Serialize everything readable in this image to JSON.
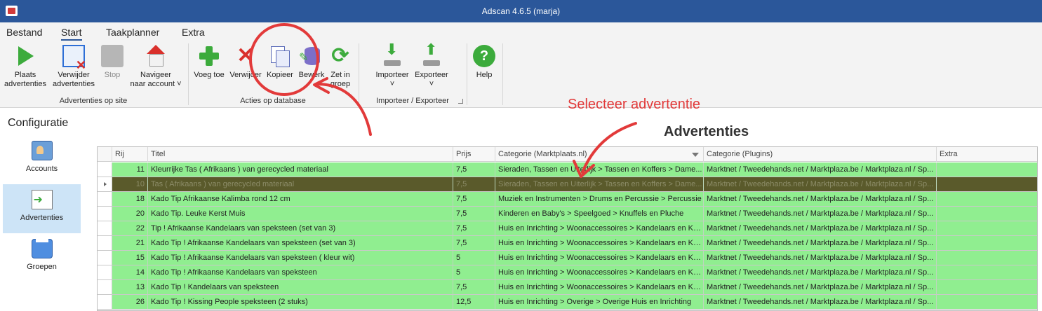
{
  "window": {
    "title": "Adscan 4.6.5 (marja)"
  },
  "menu": {
    "tabs": [
      "Bestand",
      "Start",
      "Taakplanner",
      "Extra"
    ],
    "active": "Start"
  },
  "ribbon": {
    "groups": [
      {
        "label": "Advertenties op site",
        "buttons": [
          {
            "line1": "Plaats",
            "line2": "advertenties",
            "icon": "play-icon"
          },
          {
            "line1": "Verwijder",
            "line2": "advertenties",
            "icon": "remove-ads-icon"
          },
          {
            "line1": "Stop",
            "line2": "",
            "icon": "stop-icon",
            "disabled": true
          },
          {
            "line1": "Navigeer",
            "line2": "naar account",
            "icon": "house-icon",
            "dropdown": "˅"
          }
        ]
      },
      {
        "label": "Acties op database",
        "buttons": [
          {
            "line1": "Voeg toe",
            "line2": "",
            "icon": "plus-icon"
          },
          {
            "line1": "Verwijder",
            "line2": "",
            "icon": "delete-icon"
          },
          {
            "line1": "Kopieer",
            "line2": "",
            "icon": "copy-icon"
          },
          {
            "line1": "Bewerk",
            "line2": "",
            "icon": "database-edit-icon"
          },
          {
            "line1": "Zet in",
            "line2": "groep",
            "icon": "sync-icon"
          }
        ]
      },
      {
        "label": "Importeer / Exporteer",
        "buttons": [
          {
            "line1": "Importeer",
            "line2": "",
            "icon": "import-icon",
            "dropdown": "˅"
          },
          {
            "line1": "Exporteer",
            "line2": "",
            "icon": "export-icon",
            "dropdown": "˅"
          }
        ]
      },
      {
        "label": "",
        "buttons": [
          {
            "line1": "Help",
            "line2": "",
            "icon": "help-icon"
          }
        ]
      }
    ]
  },
  "nav": {
    "title": "Configuratie",
    "items": [
      {
        "label": "Accounts",
        "icon": "accounts-icon"
      },
      {
        "label": "Advertenties",
        "icon": "advertenties-icon",
        "selected": true
      },
      {
        "label": "Groepen",
        "icon": "groepen-icon"
      }
    ]
  },
  "main": {
    "heading": "Advertenties"
  },
  "annotation": {
    "text": "Selecteer advertentie",
    "color": "#e23a3a"
  },
  "grid": {
    "columns": [
      "Rij",
      "Titel",
      "Prijs",
      "Categorie (Marktplaats.nl)",
      "Categorie (Plugins)",
      "Extra"
    ],
    "row_color": "#90ee90",
    "selected_row_color": "#5a5a2b",
    "rows": [
      {
        "rij": "11",
        "titel": "Kleurrijke  Tas ( Afrikaans ) van gerecycled materiaal",
        "prijs": "7,5",
        "cat": "Sieraden, Tassen en Uiterlijk > Tassen en Koffers > Dame...",
        "plugins": "Marktnet / Tweedehands.net / Marktplaza.be / Marktplaza.nl / Sp...",
        "extra": ""
      },
      {
        "rij": "10",
        "titel": "Tas ( Afrikaans ) van gerecycled materiaal",
        "prijs": "7,5",
        "cat": "Sieraden, Tassen en Uiterlijk > Tassen en Koffers > Dame...",
        "plugins": "Marktnet / Tweedehands.net / Marktplaza.be / Marktplaza.nl / Sp...",
        "extra": "",
        "selected": true
      },
      {
        "rij": "18",
        "titel": "Kado Tip  Afrikaanse Kalimba rond 12 cm",
        "prijs": "7,5",
        "cat": "Muziek en Instrumenten > Drums en Percussie > Percussie",
        "plugins": "Marktnet / Tweedehands.net / Marktplaza.be / Marktplaza.nl / Sp...",
        "extra": ""
      },
      {
        "rij": "20",
        "titel": "Kado Tip. Leuke Kerst Muis",
        "prijs": "7,5",
        "cat": "Kinderen en Baby's > Speelgoed > Knuffels en Pluche",
        "plugins": "Marktnet / Tweedehands.net / Marktplaza.be / Marktplaza.nl / Sp...",
        "extra": ""
      },
      {
        "rij": "22",
        "titel": " Tip ! Afrikaanse  Kandelaars van speksteen (set van 3)",
        "prijs": "7,5",
        "cat": "Huis en Inrichting > Woonaccessoires > Kandelaars en Ka...",
        "plugins": "Marktnet / Tweedehands.net / Marktplaza.be / Marktplaza.nl / Sp...",
        "extra": ""
      },
      {
        "rij": "21",
        "titel": "Kado Tip ! Afrikaanse  Kandelaars van speksteen (set van 3)",
        "prijs": "7,5",
        "cat": "Huis en Inrichting > Woonaccessoires > Kandelaars en Ka...",
        "plugins": "Marktnet / Tweedehands.net / Marktplaza.be / Marktplaza.nl / Sp...",
        "extra": ""
      },
      {
        "rij": "15",
        "titel": " Kado Tip ! Afrikaanse  Kandelaars van speksteen ( kleur wit)",
        "prijs": "5",
        "cat": "Huis en Inrichting > Woonaccessoires > Kandelaars en Ka...",
        "plugins": "Marktnet / Tweedehands.net / Marktplaza.be / Marktplaza.nl / Sp...",
        "extra": ""
      },
      {
        "rij": "14",
        "titel": " Kado Tip ! Afrikaanse  Kandelaars van speksteen",
        "prijs": "5",
        "cat": "Huis en Inrichting > Woonaccessoires > Kandelaars en Ka...",
        "plugins": "Marktnet / Tweedehands.net / Marktplaza.be / Marktplaza.nl / Sp...",
        "extra": ""
      },
      {
        "rij": "13",
        "titel": " Kado Tip ! Kandelaars van speksteen",
        "prijs": "7,5",
        "cat": "Huis en Inrichting > Woonaccessoires > Kandelaars en Ka...",
        "plugins": "Marktnet / Tweedehands.net / Marktplaza.be / Marktplaza.nl / Sp...",
        "extra": ""
      },
      {
        "rij": "26",
        "titel": " Kado Tip ! Kissing People speksteen (2 stuks)",
        "prijs": "12,5",
        "cat": "Huis en Inrichting > Overige > Overige Huis en Inrichting",
        "plugins": "Marktnet / Tweedehands.net / Marktplaza.be / Marktplaza.nl / Sp...",
        "extra": ""
      }
    ]
  }
}
